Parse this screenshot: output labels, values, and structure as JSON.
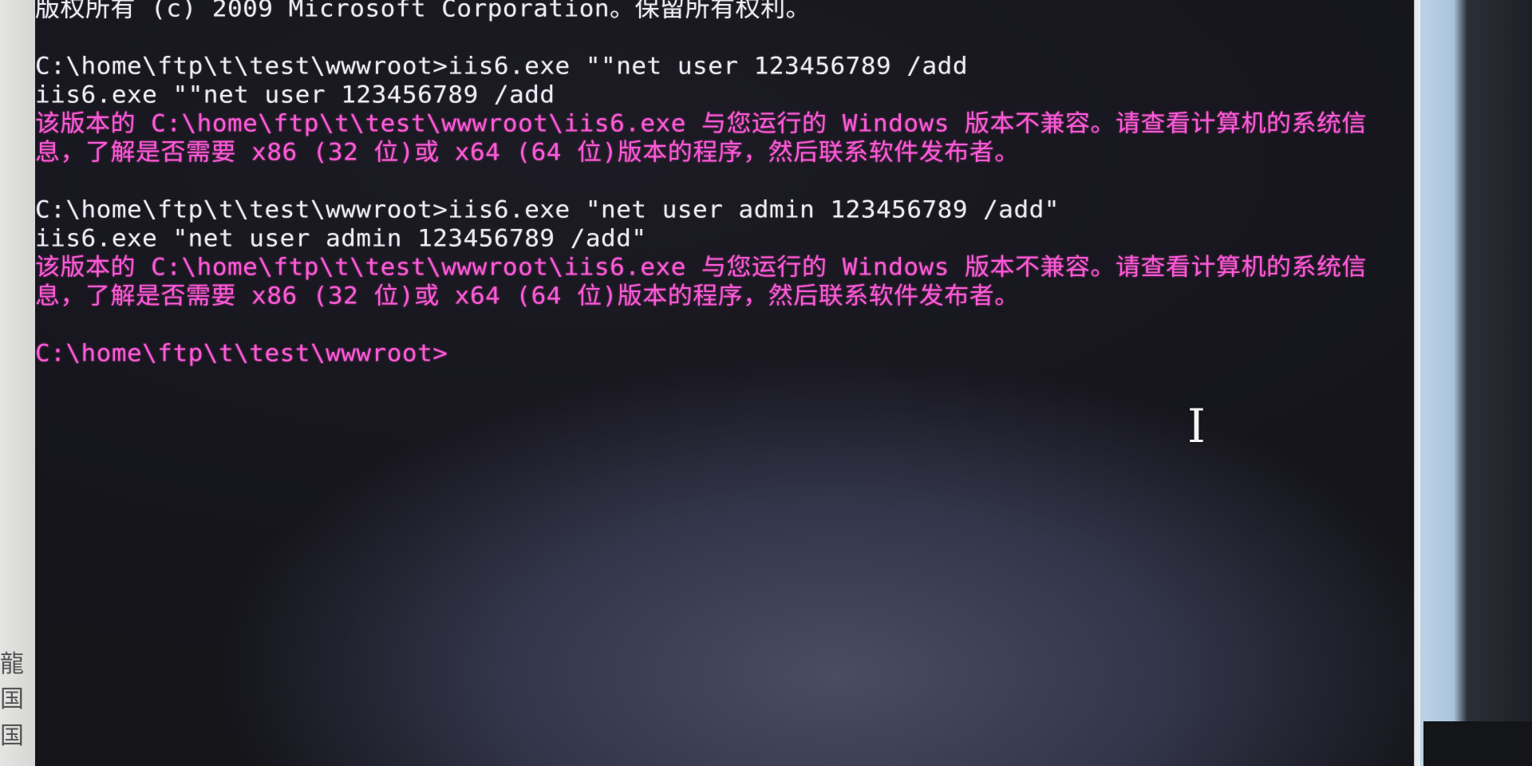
{
  "console": {
    "lines": [
      {
        "text": "版权所有 (c) 2009 Microsoft Corporation。保留所有权利。",
        "style": "white"
      },
      {
        "text": "",
        "style": "gap"
      },
      {
        "text": "C:\\home\\ftp\\t\\test\\wwwroot>iis6.exe \"\"net user 123456789 /add",
        "style": "white"
      },
      {
        "text": "iis6.exe \"\"net user 123456789 /add",
        "style": "white"
      },
      {
        "text": "该版本的 C:\\home\\ftp\\t\\test\\wwwroot\\iis6.exe 与您运行的 Windows 版本不兼容。请查看计算机的系统信",
        "style": "magenta"
      },
      {
        "text": "息，了解是否需要 x86 (32 位)或 x64 (64 位)版本的程序，然后联系软件发布者。",
        "style": "magenta"
      },
      {
        "text": "",
        "style": "gap"
      },
      {
        "text": "C:\\home\\ftp\\t\\test\\wwwroot>iis6.exe \"net user admin 123456789 /add\"",
        "style": "white"
      },
      {
        "text": "iis6.exe \"net user admin 123456789 /add\"",
        "style": "white"
      },
      {
        "text": "该版本的 C:\\home\\ftp\\t\\test\\wwwroot\\iis6.exe 与您运行的 Windows 版本不兼容。请查看计算机的系统信",
        "style": "magenta"
      },
      {
        "text": "息，了解是否需要 x86 (32 位)或 x64 (64 位)版本的程序，然后联系软件发布者。",
        "style": "magenta"
      },
      {
        "text": "",
        "style": "gap"
      },
      {
        "text": "C:\\home\\ftp\\t\\test\\wwwroot>",
        "style": "magenta"
      }
    ]
  },
  "left_strip": {
    "glyphs": [
      "龍",
      "国",
      "国"
    ]
  },
  "scrollbar": {
    "up_arrow": "^"
  },
  "cursor": {
    "glyph": "I"
  },
  "colors": {
    "console_bg": "#16151d",
    "text_white": "#e8e6f0",
    "text_magenta": "#ff5ad8"
  }
}
